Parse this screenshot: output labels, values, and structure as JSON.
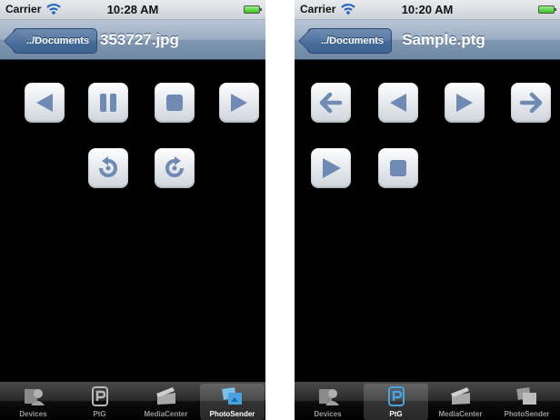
{
  "status_bar": {
    "carrier": "Carrier",
    "left_time": "10:28 AM",
    "right_time": "10:20 AM"
  },
  "left_screen": {
    "back_button": "../Documents",
    "title": "353727.jpg",
    "controls": [
      {
        "name": "previous",
        "icon": "chevron-left-icon"
      },
      {
        "name": "pause",
        "icon": "pause-icon"
      },
      {
        "name": "stop",
        "icon": "stop-icon"
      },
      {
        "name": "next",
        "icon": "chevron-right-icon"
      },
      {
        "name": "rotate-left",
        "icon": "rotate-ccw-icon"
      },
      {
        "name": "rotate-right",
        "icon": "rotate-cw-icon"
      }
    ],
    "selected_tab": "PhotoSender"
  },
  "right_screen": {
    "back_button": "../Documents",
    "title": "Sample.ptg",
    "controls": [
      {
        "name": "first",
        "icon": "arrow-left-icon"
      },
      {
        "name": "previous",
        "icon": "chevron-left-icon"
      },
      {
        "name": "next",
        "icon": "chevron-right-icon"
      },
      {
        "name": "last",
        "icon": "arrow-right-icon"
      },
      {
        "name": "play",
        "icon": "play-icon"
      },
      {
        "name": "stop",
        "icon": "stop-icon"
      }
    ],
    "selected_tab": "PtG"
  },
  "tabs": [
    {
      "label": "Devices",
      "icon": "devices-icon"
    },
    {
      "label": "PtG",
      "icon": "ptg-icon"
    },
    {
      "label": "MediaCenter",
      "icon": "clapperboard-icon"
    },
    {
      "label": "PhotoSender",
      "icon": "photos-icon"
    }
  ],
  "colors": {
    "navbar": "#8096b0",
    "icon_blue": "#6f8bb4",
    "tab_selected_icon": "#4aa3e0"
  }
}
